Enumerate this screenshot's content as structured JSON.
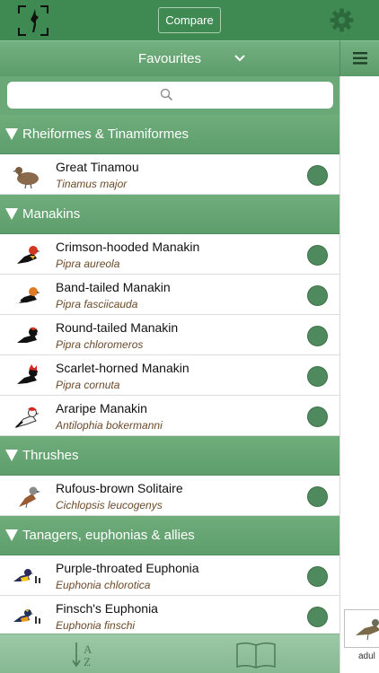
{
  "header": {
    "compare_label": "Compare",
    "logo_icon": "bird-silhouette-logo-icon",
    "settings_icon": "gear-icon"
  },
  "subheader": {
    "selected_list": "Favourites",
    "dropdown_icon": "chevron-down-icon",
    "menu_icon": "hamburger-menu-icon"
  },
  "search": {
    "placeholder": "",
    "icon": "search-icon"
  },
  "colors": {
    "brand_green": "#3f8a52",
    "section_green": "#6aa877",
    "status_dot": "#4e8a5e",
    "latin_name": "#6b4a2a"
  },
  "groups": [
    {
      "title": "Rheiformes & Tinamiformes",
      "birds": [
        {
          "name": "Great Tinamou",
          "latin": "Tinamus major"
        }
      ]
    },
    {
      "title": "Manakins",
      "birds": [
        {
          "name": "Crimson-hooded Manakin",
          "latin": "Pipra aureola"
        },
        {
          "name": "Band-tailed Manakin",
          "latin": "Pipra fasciicauda"
        },
        {
          "name": "Round-tailed Manakin",
          "latin": "Pipra chloromeros"
        },
        {
          "name": "Scarlet-horned Manakin",
          "latin": "Pipra cornuta"
        },
        {
          "name": "Araripe Manakin",
          "latin": "Antilophia bokermanni"
        }
      ]
    },
    {
      "title": "Thrushes",
      "birds": [
        {
          "name": "Rufous-brown Solitaire",
          "latin": "Cichlopsis leucogenys"
        }
      ]
    },
    {
      "title": "Tanagers, euphonias & allies",
      "birds": [
        {
          "name": "Purple-throated Euphonia",
          "latin": "Euphonia chlorotica"
        },
        {
          "name": "Finsch's Euphonia",
          "latin": "Euphonia finschi"
        }
      ]
    }
  ],
  "bottombar": {
    "sort_icon": "sort-az-icon",
    "sort_letters": "AZ",
    "book_icon": "book-icon"
  },
  "detail": {
    "thumbnail_label": "adul"
  }
}
